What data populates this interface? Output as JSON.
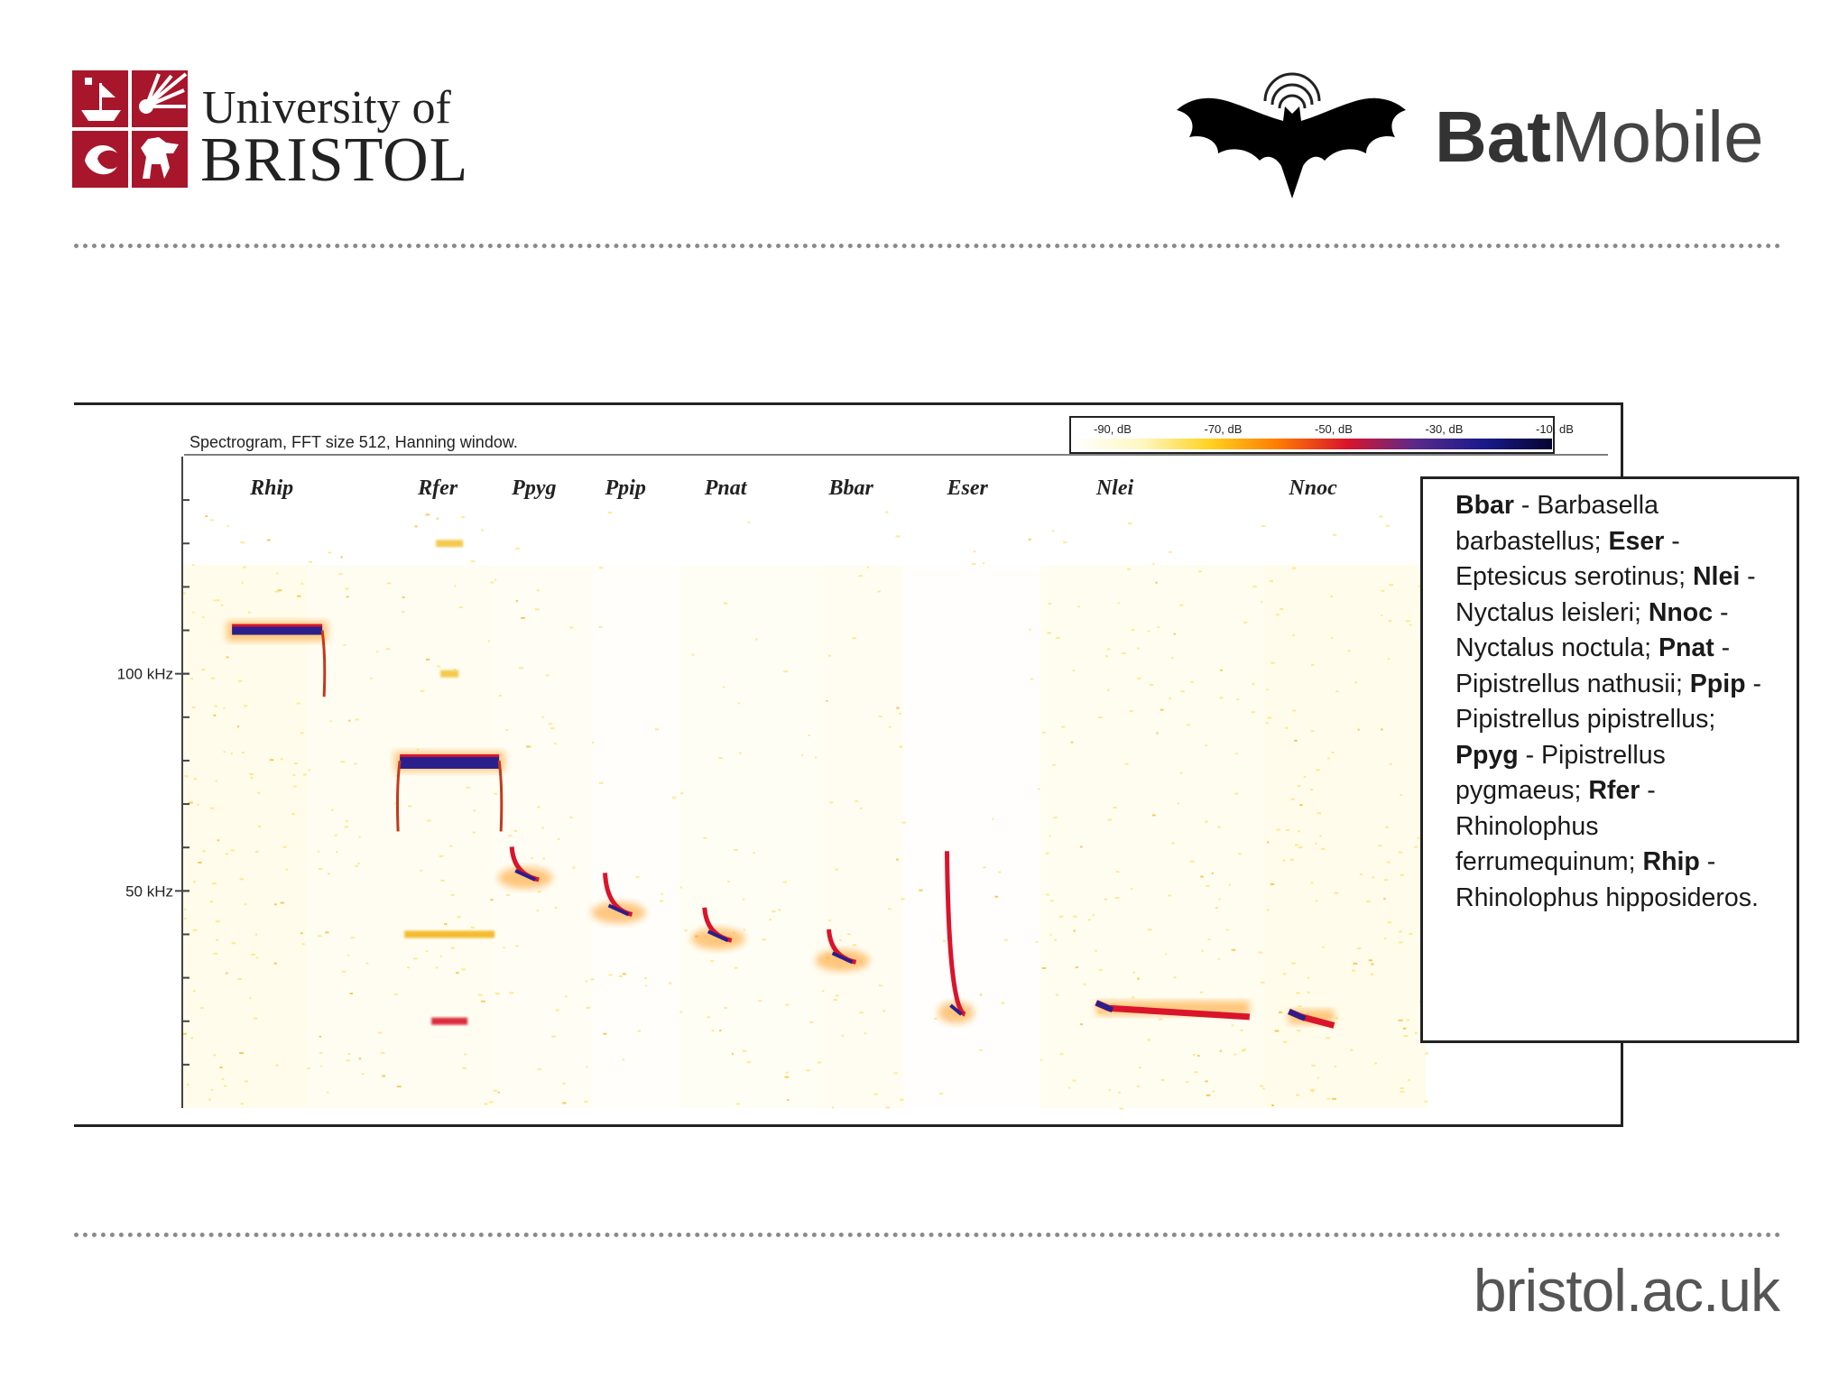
{
  "header": {
    "university_line1": "University of",
    "university_line2": "BRISTOL",
    "brand_bold": "Bat",
    "brand_regular": "Mobile",
    "logo_color": "#a8162b"
  },
  "footer": {
    "url": "bristol.ac.uk"
  },
  "chart_data": {
    "type": "heatmap",
    "title": "Spectrogram, FFT size 512, Hanning window.",
    "colorbar": {
      "labels": [
        "-90, dB",
        "-70, dB",
        "-50, dB",
        "-30, dB",
        "-10, dB"
      ],
      "colors": [
        "#ffffff",
        "#fff7c0",
        "#ffd21f",
        "#ff7a00",
        "#d9142b",
        "#5a2a8a",
        "#1a1a8c",
        "#050530"
      ]
    },
    "y_ticks": [
      {
        "value": 100,
        "label": "100 kHz"
      },
      {
        "value": 50,
        "label": "50 kHz"
      }
    ],
    "ylim": [
      0,
      150
    ],
    "species": [
      {
        "label": "Rhip",
        "x": 0.04,
        "call": "cf",
        "freq_start": 110,
        "freq_end": 103,
        "intensity": 1.0
      },
      {
        "label": "Rfer",
        "x": 0.175,
        "call": "cf",
        "freq_start": 80,
        "freq_end": 72,
        "intensity": 1.0
      },
      {
        "label": "Ppyg",
        "x": 0.265,
        "call": "fm",
        "freq_start": 56,
        "freq_end": 53,
        "intensity": 0.8
      },
      {
        "label": "Ppip",
        "x": 0.34,
        "call": "fm",
        "freq_start": 50,
        "freq_end": 45,
        "intensity": 0.8
      },
      {
        "label": "Pnat",
        "x": 0.42,
        "call": "fm",
        "freq_start": 42,
        "freq_end": 39,
        "intensity": 0.8
      },
      {
        "label": "Bbar",
        "x": 0.52,
        "call": "fm",
        "freq_start": 37,
        "freq_end": 34,
        "intensity": 0.8
      },
      {
        "label": "Eser",
        "x": 0.615,
        "call": "fm",
        "freq_start": 55,
        "freq_end": 22,
        "intensity": 0.7
      },
      {
        "label": "Nlei",
        "x": 0.735,
        "call": "qcf",
        "freq_start": 23,
        "freq_end": 21,
        "intensity": 0.8
      },
      {
        "label": "Nnoc",
        "x": 0.89,
        "call": "qcf",
        "freq_start": 21,
        "freq_end": 19,
        "intensity": 0.8
      }
    ]
  },
  "legend": [
    {
      "abbr": "Bbar",
      "sep": " - ",
      "name": "Barbasella barbastellus;"
    },
    {
      "abbr": "Eser",
      "sep": " - ",
      "name": "Eptesicus serotinus;"
    },
    {
      "abbr": "Nlei",
      "sep": " - ",
      "name": "Nyctalus leisleri;"
    },
    {
      "abbr": "Nnoc",
      "sep": " - ",
      "name": "Nyctalus noctula;"
    },
    {
      "abbr": "Pnat",
      "sep": " - ",
      "name": "Pipistrellus nathusii;"
    },
    {
      "abbr": "Ppip",
      "sep": " - ",
      "name": "Pipistrellus pipistrellus;"
    },
    {
      "abbr": "Ppyg",
      "sep": " - ",
      "name": "Pipistrellus pygmaeus;"
    },
    {
      "abbr": "Rfer",
      "sep": " - ",
      "name": "Rhinolophus ferrumequinum;"
    },
    {
      "abbr": "Rhip",
      "sep": " - ",
      "name": "Rhinolophus hipposideros."
    }
  ]
}
